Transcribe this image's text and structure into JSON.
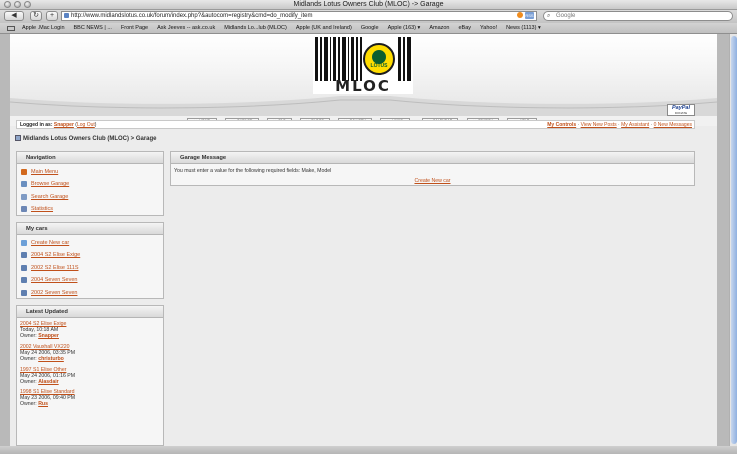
{
  "browser": {
    "window_title": "Midlands Lotus Owners Club (MLOC) -> Garage",
    "url": "http://www.midlandslotus.co.uk/forum/index.php?&autocom=registry&cmd=do_modify_item",
    "search_placeholder": "Google",
    "rss_label": "RSS",
    "back_glyph": "◀",
    "forward_glyph": "▶",
    "reload_glyph": "↻",
    "add_glyph": "+",
    "bookmarks": [
      "Apple .Mac Login",
      "BBC NEWS | ...",
      "Front Page",
      "Ask Jeeves -- ask.co.uk",
      "Midlands Lo...lub (MLOC)",
      "Apple (UK and Ireland)",
      "Google",
      "Apple (163) ▾",
      "Amazon",
      "eBay",
      "Yahoo!",
      "News (1113) ▾"
    ]
  },
  "header": {
    "logo_text": "MLOC",
    "badge_text": "LOTUS"
  },
  "nav": {
    "tabs": [
      ">> HOME",
      ">> GARAGE",
      ">> FAQ",
      ">> BLOGS",
      ">> GALLERY",
      ">> LINKS",
      ">> CALENDAR",
      ">> SEARCH",
      ">> HELP"
    ]
  },
  "paypal": {
    "logo": "PayPal",
    "sub": "DONATE"
  },
  "login": {
    "prefix": "Logged in as:",
    "user": "Snapper",
    "sep1": "(",
    "logout": "Log Out",
    "sep2": ")",
    "my_controls": "My Controls",
    "view_new_posts": "View New Posts",
    "my_assistant": "My Assistant",
    "new_messages": "0 New Messages",
    "divider": "·"
  },
  "breadcrumb": "Midlands Lotus Owners Club (MLOC) > Garage",
  "navigation_panel": {
    "title": "Navigation",
    "items": [
      {
        "label": "Main Menu",
        "icon": "home-icon",
        "color": "#d2691e"
      },
      {
        "label": "Browse Garage",
        "icon": "folder-icon",
        "color": "#6a8fbf"
      },
      {
        "label": "Search Garage",
        "icon": "magnifier-icon",
        "color": "#7f9bc4"
      },
      {
        "label": "Statistics",
        "icon": "chart-icon",
        "color": "#6d87b5"
      }
    ]
  },
  "mycars_panel": {
    "title": "My cars",
    "items": [
      {
        "label": "Create New car",
        "icon": "add-icon",
        "color": "#6da0d8"
      },
      {
        "label": "2004 S2 Elise Exige",
        "icon": "car-icon",
        "color": "#5f7fb0"
      },
      {
        "label": "2002 S2 Elise 111S",
        "icon": "car-icon",
        "color": "#5f7fb0"
      },
      {
        "label": "2004 Seven Seven",
        "icon": "car-icon",
        "color": "#5f7fb0"
      },
      {
        "label": "2002 Seven Seven",
        "icon": "car-icon",
        "color": "#5f7fb0"
      }
    ]
  },
  "latest_panel": {
    "title": "Latest Updated",
    "owner_prefix": "Owner:",
    "entries": [
      {
        "title": "2004 S2 Elise Exige",
        "date": "Today, 10:18 AM",
        "owner": "Snapper"
      },
      {
        "title": "2002 Vauxhall VX220",
        "date": "May 24 2006, 03:35 PM",
        "owner": "christurbo"
      },
      {
        "title": "1997 S1 Elise Other",
        "date": "May 24 2006, 01:16 PM",
        "owner": "Alasdair"
      },
      {
        "title": "1998 S1 Elise Standard",
        "date": "May 23 2006, 09:40 PM",
        "owner": "Rus"
      }
    ]
  },
  "garage_message": {
    "title": "Garage Message",
    "text": "You must enter a value for the following required fields: Make, Model",
    "link": "Create New car"
  },
  "colors": {
    "link": "#c0501a",
    "panel_bg": "#f6f6f6",
    "content_bg": "#ececec"
  }
}
